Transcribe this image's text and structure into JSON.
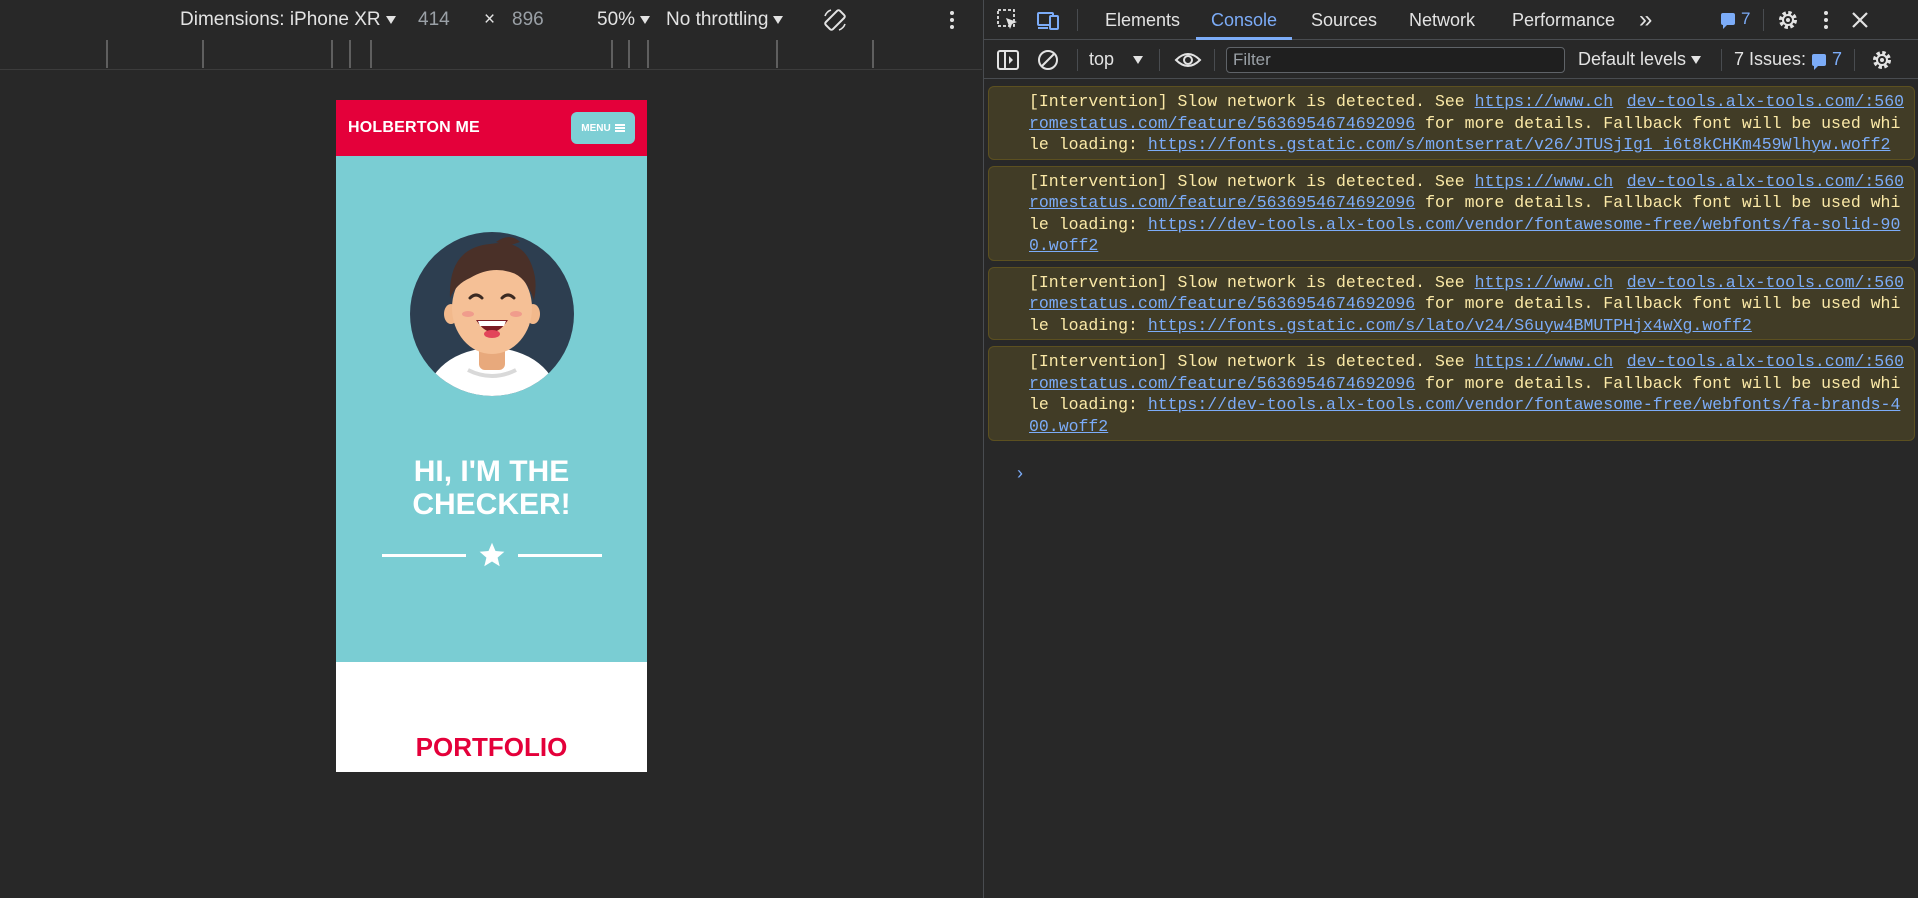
{
  "device_toolbar": {
    "dimensions_label": "Dimensions: iPhone XR",
    "width": "414",
    "times": "×",
    "height": "896",
    "zoom": "50%",
    "throttling": "No throttling"
  },
  "page": {
    "logo": "HOLBERTON ME",
    "menu_label": "MENU",
    "hero_title_line1": "HI, I'M THE",
    "hero_title_line2": "CHECKER!",
    "portfolio_title": "PORTFOLIO",
    "colors": {
      "header": "#e4003a",
      "hero": "#7acdd3",
      "menu_button": "#7ecfd5"
    }
  },
  "devtools": {
    "tabs": [
      "Elements",
      "Console",
      "Sources",
      "Network",
      "Performance"
    ],
    "active_tab": "Console",
    "more_tabs": "»",
    "issues_badge": "7",
    "console_toolbar": {
      "context": "top",
      "filter_placeholder": "Filter",
      "levels": "Default levels",
      "issues_label": "7 Issues:",
      "issues_num": "7"
    },
    "messages": [
      {
        "prefix": "[Intervention] Slow network is detected. See ",
        "link1": "https://www.chromestatus.com/feature/5636954674692096",
        "middle": " for more details. Fallback font will be used while loading: ",
        "link2": "https://fonts.gstatic.com/s/montserrat/v26/JTUSjIg1_i6t8kCHKm459Wlhyw.woff2",
        "source": "dev-tools.alx-tools.com/:560"
      },
      {
        "prefix": "[Intervention] Slow network is detected. See ",
        "link1": "https://www.chromestatus.com/feature/5636954674692096",
        "middle": " for more details. Fallback font will be used while loading: ",
        "link2": "https://dev-tools.alx-tools.com/vendor/fontawesome-free/webfonts/fa-solid-900.woff2",
        "source": "dev-tools.alx-tools.com/:560"
      },
      {
        "prefix": "[Intervention] Slow network is detected. See ",
        "link1": "https://www.chromestatus.com/feature/5636954674692096",
        "middle": " for more details. Fallback font will be used while loading: ",
        "link2": "https://fonts.gstatic.com/s/lato/v24/S6uyw4BMUTPHjx4wXg.woff2",
        "source": "dev-tools.alx-tools.com/:560"
      },
      {
        "prefix": "[Intervention] Slow network is detected. See ",
        "link1": "https://www.chromestatus.com/feature/5636954674692096",
        "middle": " for more details. Fallback font will be used while loading: ",
        "link2": "https://dev-tools.alx-tools.com/vendor/fontawesome-free/webfonts/fa-brands-400.woff2",
        "source": "dev-tools.alx-tools.com/:560"
      }
    ],
    "prompt": "›"
  }
}
